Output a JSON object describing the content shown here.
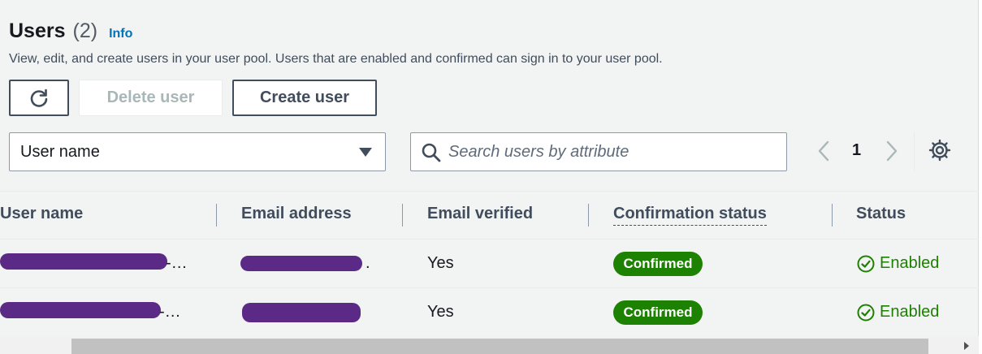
{
  "header": {
    "title": "Users",
    "count": "(2)",
    "info_label": "Info",
    "description": "View, edit, and create users in your user pool. Users that are enabled and confirmed can sign in to your user pool."
  },
  "toolbar": {
    "refresh_icon": "refresh-icon",
    "delete_label": "Delete user",
    "create_label": "Create user"
  },
  "filter": {
    "property_selected": "User name",
    "search_placeholder": "Search users by attribute",
    "search_value": ""
  },
  "pagination": {
    "current_page": "1"
  },
  "table": {
    "columns": [
      "User name",
      "Email address",
      "Email verified",
      "Confirmation status",
      "Status"
    ],
    "rows": [
      {
        "user_name_suffix": "-…",
        "email_suffix": ".",
        "email_verified": "Yes",
        "confirmation_status": "Confirmed",
        "status": "Enabled"
      },
      {
        "user_name_suffix": "-…",
        "email_suffix": "",
        "email_verified": "Yes",
        "confirmation_status": "Confirmed",
        "status": "Enabled"
      }
    ]
  },
  "colors": {
    "status_green": "#1d8102",
    "link_blue": "#0073bb",
    "redaction": "#5b2a86"
  }
}
